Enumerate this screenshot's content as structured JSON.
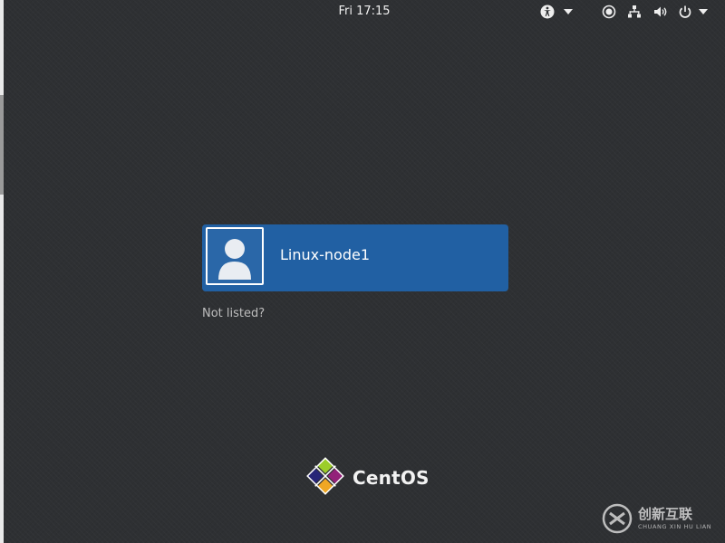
{
  "topbar": {
    "clock": "Fri 17:15",
    "icons": [
      "accessibility-icon",
      "chevron-down-icon",
      "display-brightness-icon",
      "network-icon",
      "volume-icon",
      "power-icon",
      "chevron-down-icon"
    ]
  },
  "users": [
    {
      "name": "Linux-node1",
      "avatar": "user-silhouette-icon"
    }
  ],
  "login": {
    "not_listed": "Not listed?"
  },
  "branding": {
    "distro": "CentOS",
    "logo": "centos-logo-icon"
  },
  "watermark": {
    "title": "创新互联",
    "subtitle": "CHUANG XIN HU LIAN"
  },
  "colors": {
    "background": "#2e3033",
    "user_card": "#2160a3",
    "topbar_text": "#f0f0f0",
    "muted_link": "#bdbdbd"
  }
}
